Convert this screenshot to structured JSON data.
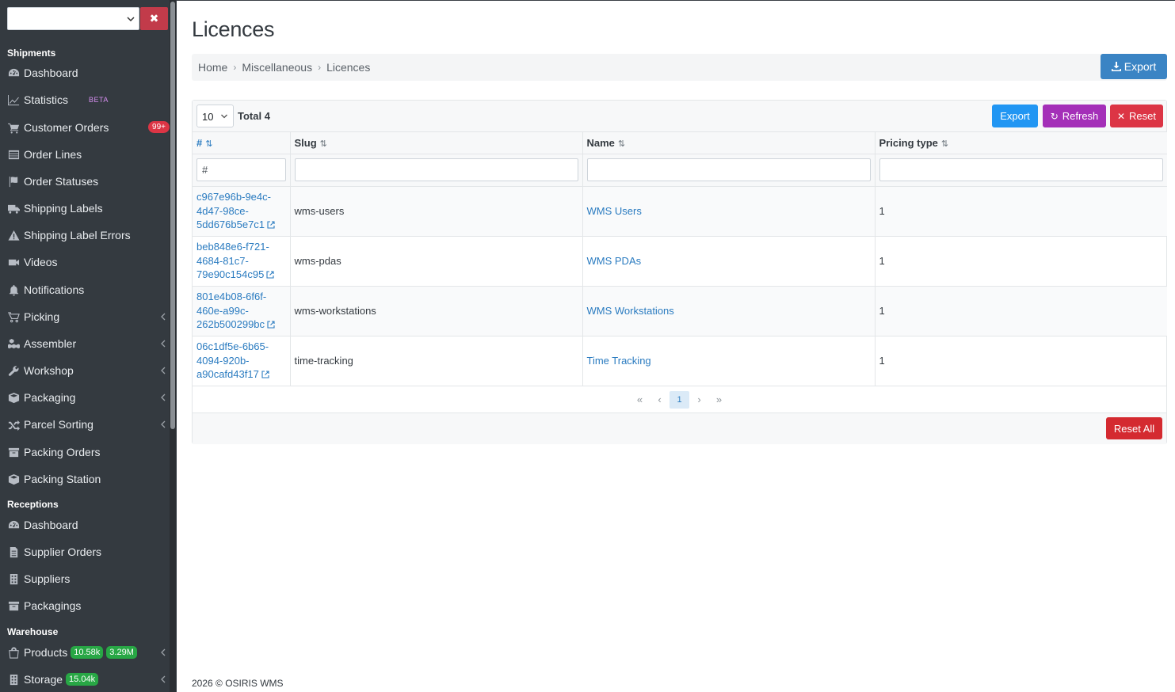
{
  "sidebar": {
    "sections": {
      "shipments": "Shipments",
      "receptions": "Receptions",
      "warehouse": "Warehouse"
    },
    "items": {
      "dashboard": "Dashboard",
      "statistics": "Statistics",
      "statistics_badge": "BETA",
      "customer_orders": "Customer Orders",
      "customer_orders_badge": "99+",
      "order_lines": "Order Lines",
      "order_statuses": "Order Statuses",
      "shipping_labels": "Shipping Labels",
      "shipping_label_errors": "Shipping Label Errors",
      "videos": "Videos",
      "notifications": "Notifications",
      "picking": "Picking",
      "assembler": "Assembler",
      "workshop": "Workshop",
      "packaging": "Packaging",
      "parcel_sorting": "Parcel Sorting",
      "packing_orders": "Packing Orders",
      "packing_station": "Packing Station",
      "rec_dashboard": "Dashboard",
      "supplier_orders": "Supplier Orders",
      "suppliers": "Suppliers",
      "packagings": "Packagings",
      "products": "Products",
      "products_badge1": "10.58k",
      "products_badge2": "3.29M",
      "storage": "Storage",
      "storage_badge": "15.04k"
    },
    "clear_label": "✖"
  },
  "page": {
    "title": "Licences",
    "breadcrumb": [
      "Home",
      "Miscellaneous",
      "Licences"
    ],
    "export_top_label": "Export"
  },
  "table_toolbar": {
    "per_page": "10",
    "total": "Total 4",
    "export_label": "Export",
    "refresh_label": "Refresh",
    "reset_label": "Reset"
  },
  "table": {
    "headers": [
      "#",
      "Slug",
      "Name",
      "Pricing type"
    ],
    "filter_id_value": "#",
    "rows": [
      {
        "id_lines": [
          "c967e96b-9e4c-",
          "4d47-98ce-",
          "5dd676b5e7c1"
        ],
        "slug": "wms-users",
        "name": "WMS Users",
        "pricing": "1"
      },
      {
        "id_lines": [
          "beb848e6-f721-",
          "4684-81c7-",
          "79e90c154c95"
        ],
        "slug": "wms-pdas",
        "name": "WMS PDAs",
        "pricing": "1"
      },
      {
        "id_lines": [
          "801e4b08-6f6f-",
          "460e-a99c-",
          "262b500299bc"
        ],
        "slug": "wms-workstations",
        "name": "WMS Workstations",
        "pricing": "1"
      },
      {
        "id_lines": [
          "06c1df5e-6b65-",
          "4094-920b-",
          "a90cafd43f17"
        ],
        "slug": "time-tracking",
        "name": "Time Tracking",
        "pricing": "1"
      }
    ]
  },
  "pagination": {
    "first": "«",
    "prev": "‹",
    "current": "1",
    "next": "›",
    "last": "»"
  },
  "reset_all_label": "Reset All",
  "footer": "2026 © OSIRIS WMS",
  "colors": {
    "sidebar_bg": "#343a40",
    "link": "#2a7bc0",
    "export_btn": "#2196f3",
    "refresh_btn": "#a42fb8",
    "reset_btn": "#dc3545"
  }
}
